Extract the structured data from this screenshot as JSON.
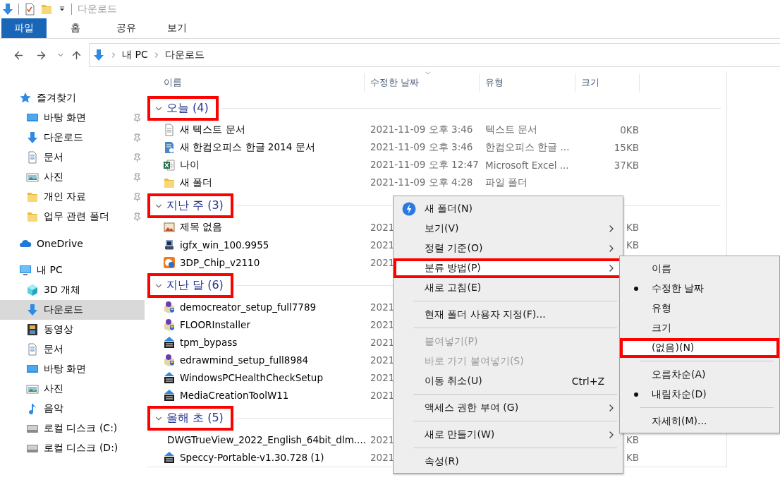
{
  "title_bar": {
    "title": "다운로드"
  },
  "ribbon_tabs": [
    {
      "label": "파일",
      "selected": true
    },
    {
      "label": "홈",
      "selected": false
    },
    {
      "label": "공유",
      "selected": false
    },
    {
      "label": "보기",
      "selected": false
    }
  ],
  "address_bar": {
    "path": [
      "내 PC",
      "다운로드"
    ]
  },
  "nav_pane": {
    "items": [
      {
        "label": "즐겨찾기",
        "kind": "star",
        "selected": false,
        "children": [
          {
            "label": "바탕 화면",
            "kind": "desktop",
            "pinned": true,
            "selected": false
          },
          {
            "label": "다운로드",
            "kind": "download",
            "pinned": true,
            "selected": false
          },
          {
            "label": "문서",
            "kind": "document",
            "pinned": true,
            "selected": false
          },
          {
            "label": "사진",
            "kind": "picture",
            "pinned": true,
            "selected": false
          },
          {
            "label": "개인 자료",
            "kind": "folder",
            "pinned": true,
            "selected": false
          },
          {
            "label": "업무 관련 폴더",
            "kind": "folder",
            "pinned": true,
            "selected": false
          }
        ]
      },
      {
        "label": "OneDrive",
        "kind": "cloud",
        "selected": false
      },
      {
        "label": "내 PC",
        "kind": "pc",
        "selected": false,
        "children": [
          {
            "label": "3D 개체",
            "kind": "cube",
            "selected": false
          },
          {
            "label": "다운로드",
            "kind": "download",
            "selected": true
          },
          {
            "label": "동영상",
            "kind": "video",
            "selected": false
          },
          {
            "label": "문서",
            "kind": "document",
            "selected": false
          },
          {
            "label": "바탕 화면",
            "kind": "desktop",
            "selected": false
          },
          {
            "label": "사진",
            "kind": "picture",
            "selected": false
          },
          {
            "label": "음악",
            "kind": "music",
            "selected": false
          },
          {
            "label": "로컬 디스크 (C:)",
            "kind": "drive",
            "selected": false
          },
          {
            "label": "로컬 디스크 (D:)",
            "kind": "drive",
            "selected": false
          }
        ]
      }
    ]
  },
  "file_list": {
    "columns": [
      {
        "label": "이름",
        "sorted": false
      },
      {
        "label": "수정한 날짜",
        "sorted": true
      },
      {
        "label": "유형",
        "sorted": false
      },
      {
        "label": "크기",
        "sorted": false
      }
    ],
    "groups": [
      {
        "label": "오늘 (4)",
        "expanded": true,
        "annotated": true,
        "rows": [
          {
            "kind": "text",
            "name": "새 텍스트 문서",
            "date": "2021-11-09 오후 3:46",
            "type": "텍스트 문서",
            "size": "0KB"
          },
          {
            "kind": "hwp",
            "name": "새 한컴오피스 한글 2014 문서",
            "date": "2021-11-09 오후 3:46",
            "type": "한컴오피스 한글 ...",
            "size": "15KB"
          },
          {
            "kind": "excel",
            "name": "나이",
            "date": "2021-11-09 오후 12:47",
            "type": "Microsoft Excel ...",
            "size": "37KB"
          },
          {
            "kind": "folder",
            "name": "새 폴더",
            "date": "2021-11-09 오후 4:28",
            "type": "파일 폴더"
          }
        ]
      },
      {
        "label": "지난 주 (3)",
        "expanded": true,
        "annotated": true,
        "rows": [
          {
            "kind": "image",
            "name": "제목 없음",
            "date": "2021",
            "size": "KB"
          },
          {
            "kind": "app",
            "name": "igfx_win_100.9955",
            "date": "2021",
            "size": "KB"
          },
          {
            "kind": "disc",
            "name": "3DP_Chip_v2110",
            "date": "2021"
          }
        ]
      },
      {
        "label": "지난 달 (6)",
        "expanded": true,
        "annotated": true,
        "rows": [
          {
            "kind": "installer",
            "name": "democreator_setup_full7789",
            "date": "2021"
          },
          {
            "kind": "installer",
            "name": "FLOORInstaller",
            "date": "2021"
          },
          {
            "kind": "zip",
            "name": "tpm_bypass",
            "date": "2021"
          },
          {
            "kind": "installer",
            "name": "edrawmind_setup_full8984",
            "date": "2021"
          },
          {
            "kind": "zip",
            "name": "WindowsPCHealthCheckSetup",
            "date": "2021"
          },
          {
            "kind": "zip",
            "name": "MediaCreationToolW11",
            "date": "2021"
          }
        ]
      },
      {
        "label": "올해 초 (5)",
        "expanded": true,
        "annotated": true,
        "rows": [
          {
            "kind": "download",
            "name": "DWGTrueView_2022_English_64bit_dlm....",
            "date": "2021",
            "size": "KB"
          },
          {
            "kind": "zip",
            "name": "Speccy-Portable-v1.30.728 (1)",
            "date": "2021",
            "size": "KB"
          }
        ]
      }
    ]
  },
  "context_menu": {
    "items": [
      {
        "kind": "icon",
        "label": "새 폴더(N)",
        "disabled": false,
        "selected": false,
        "annotated": false
      },
      {
        "kind": "submenu",
        "label": "보기(V)",
        "disabled": false,
        "selected": false,
        "annotated": false
      },
      {
        "kind": "submenu",
        "label": "정렬 기준(O)",
        "disabled": false,
        "selected": false,
        "annotated": false
      },
      {
        "kind": "submenu",
        "label": "분류 방법(P)",
        "disabled": false,
        "selected": true,
        "annotated": true
      },
      {
        "kind": "item",
        "label": "새로 고침(E)",
        "disabled": false,
        "selected": false,
        "annotated": false
      },
      {
        "kind": "separator"
      },
      {
        "kind": "item",
        "label": "현재 폴더 사용자 지정(F)...",
        "disabled": false,
        "selected": false,
        "annotated": false
      },
      {
        "kind": "separator"
      },
      {
        "kind": "item",
        "label": "붙여넣기(P)",
        "disabled": true,
        "selected": false,
        "annotated": false
      },
      {
        "kind": "item",
        "label": "바로 가기 붙여넣기(S)",
        "disabled": true,
        "selected": false,
        "annotated": false
      },
      {
        "kind": "item",
        "label": "이동 취소(U)",
        "shortcut": "Ctrl+Z",
        "disabled": false,
        "selected": false,
        "annotated": false
      },
      {
        "kind": "separator"
      },
      {
        "kind": "submenu",
        "label": "액세스 권한 부여 (G)",
        "disabled": false,
        "selected": false,
        "annotated": false
      },
      {
        "kind": "separator"
      },
      {
        "kind": "submenu",
        "label": "새로 만들기(W)",
        "disabled": false,
        "selected": false,
        "annotated": false
      },
      {
        "kind": "separator"
      },
      {
        "kind": "item",
        "label": "속성(R)",
        "disabled": false,
        "selected": false,
        "annotated": false
      }
    ]
  },
  "submenu": {
    "items": [
      {
        "kind": "item",
        "label": "이름",
        "checked": false,
        "selected": false,
        "annotated": false
      },
      {
        "kind": "item",
        "label": "수정한 날짜",
        "checked": true,
        "selected": false,
        "annotated": false
      },
      {
        "kind": "item",
        "label": "유형",
        "checked": false,
        "selected": false,
        "annotated": false
      },
      {
        "kind": "item",
        "label": "크기",
        "checked": false,
        "selected": false,
        "annotated": false
      },
      {
        "kind": "item",
        "label": "(없음)(N)",
        "checked": false,
        "selected": true,
        "annotated": true
      },
      {
        "kind": "separator"
      },
      {
        "kind": "item",
        "label": "오름차순(A)",
        "checked": false,
        "selected": false,
        "annotated": false
      },
      {
        "kind": "item",
        "label": "내림차순(D)",
        "checked": true,
        "selected": false,
        "annotated": false
      },
      {
        "kind": "separator"
      },
      {
        "kind": "item",
        "label": "자세히(M)...",
        "checked": false,
        "selected": false,
        "annotated": false
      }
    ]
  }
}
